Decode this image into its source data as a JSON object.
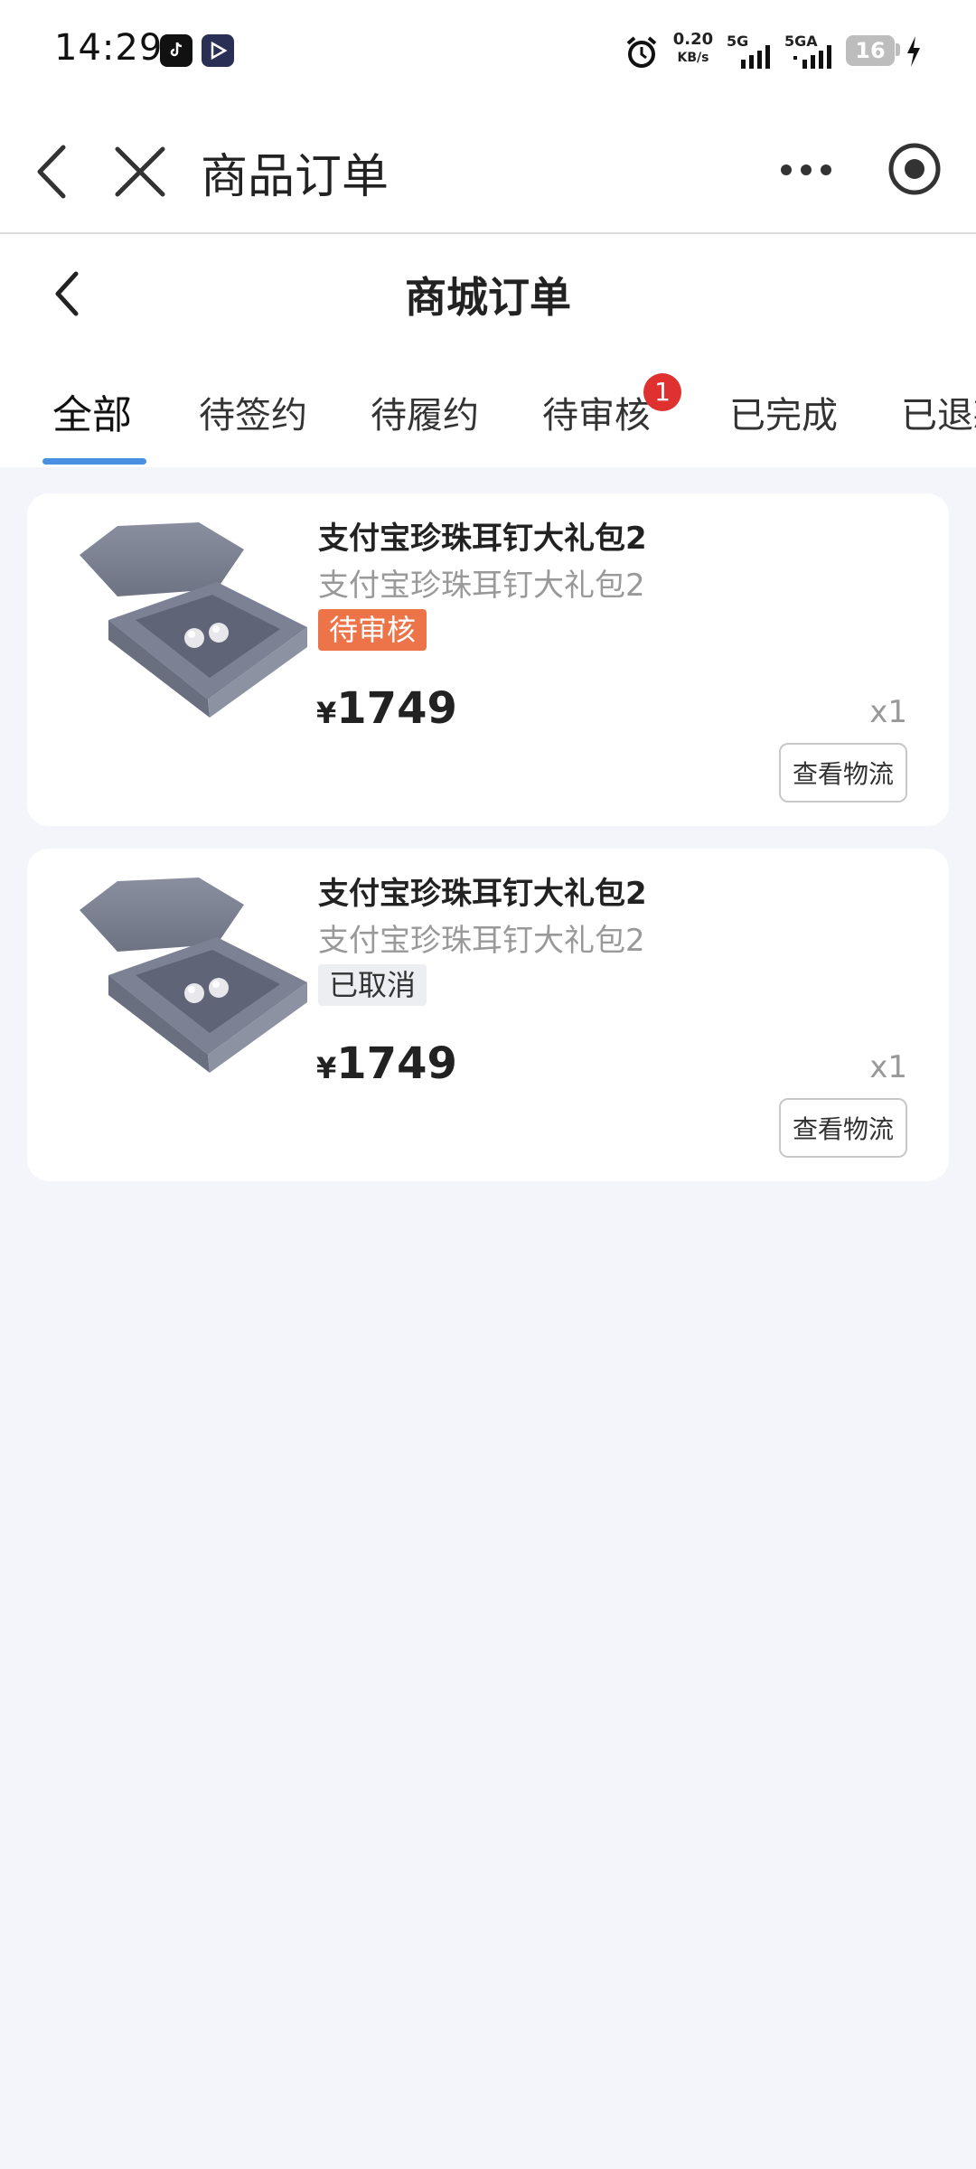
{
  "status_bar": {
    "time": "14:29",
    "speed_value": "0.20",
    "speed_unit": "KB/s",
    "net1": "5G",
    "net2": "5GA",
    "battery": "16",
    "icons": [
      "tiktok-icon",
      "app-icon",
      "alarm-icon",
      "signal-icon",
      "signal-icon",
      "battery-icon",
      "charging-icon"
    ]
  },
  "app_header": {
    "title": "商品订单",
    "icons": [
      "back-icon",
      "close-icon",
      "more-icon",
      "target-icon"
    ]
  },
  "page_header": {
    "title": "商城订单"
  },
  "tabs": [
    {
      "label": "全部",
      "active": true
    },
    {
      "label": "待签约"
    },
    {
      "label": "待履约"
    },
    {
      "label": "待审核",
      "badge": "1"
    },
    {
      "label": "已完成"
    },
    {
      "label": "已退款"
    }
  ],
  "orders": [
    {
      "title": "支付宝珍珠耳钉大礼包2",
      "subtitle": "支付宝珍珠耳钉大礼包2",
      "status": "待审核",
      "currency": "¥",
      "price": "1749",
      "qty": "x1",
      "action": "查看物流"
    },
    {
      "title": "支付宝珍珠耳钉大礼包2",
      "subtitle": "支付宝珍珠耳钉大礼包2",
      "status": "已取消",
      "currency": "¥",
      "price": "1749",
      "qty": "x1",
      "action": "查看物流"
    }
  ],
  "colors": {
    "accent": "#4a90e2",
    "badge": "#e03131",
    "status_pending": "#ed7348",
    "background": "#f4f5fa"
  }
}
